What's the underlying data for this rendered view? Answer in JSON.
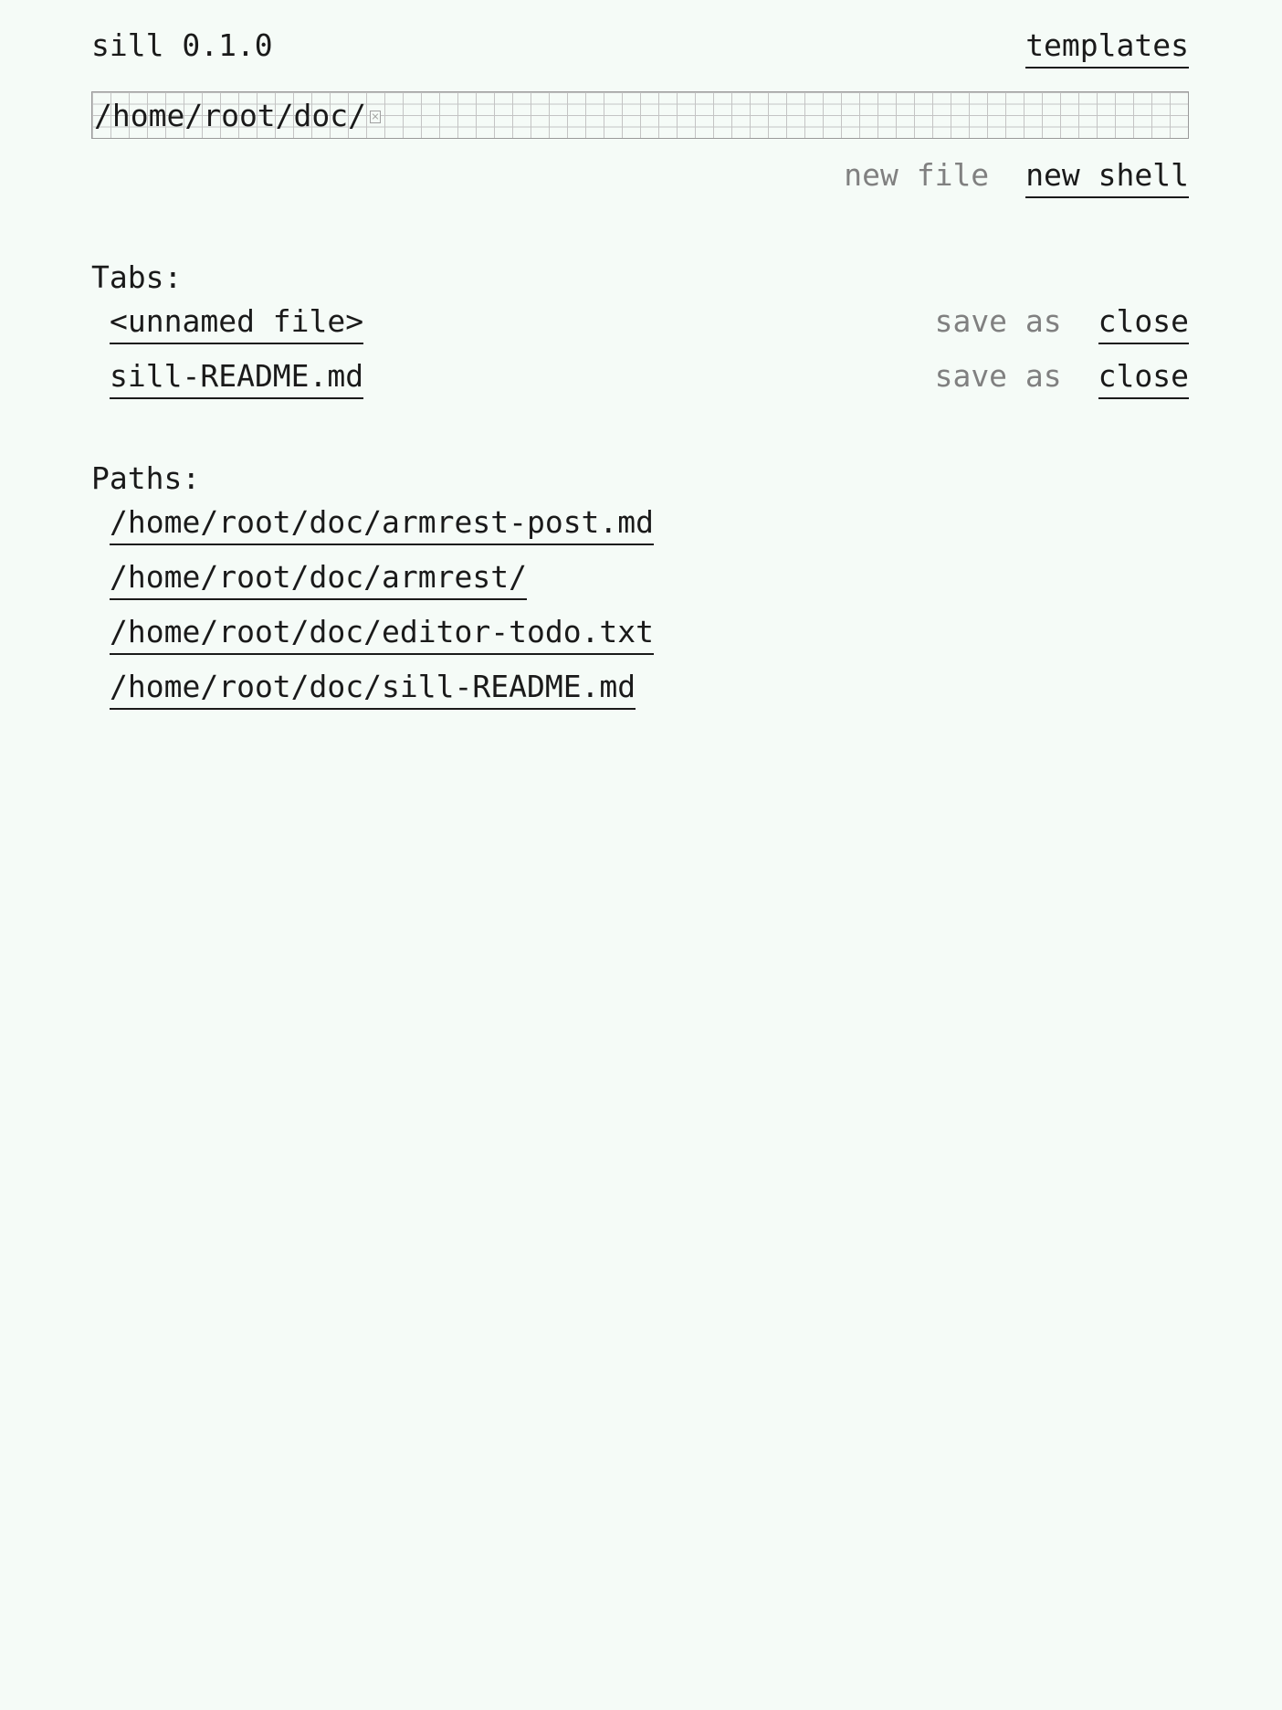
{
  "header": {
    "app_title": "sill 0.1.0",
    "templates_label": "templates"
  },
  "path_input": {
    "value": "/home/root/doc/"
  },
  "actions": {
    "new_file_label": "new file",
    "new_shell_label": "new shell"
  },
  "tabs": {
    "heading": "Tabs:",
    "items": [
      {
        "name": "<unnamed file>",
        "save_as_label": "save as",
        "close_label": "close"
      },
      {
        "name": "sill-README.md",
        "save_as_label": "save as",
        "close_label": "close"
      }
    ]
  },
  "paths": {
    "heading": "Paths:",
    "items": [
      "/home/root/doc/armrest-post.md",
      "/home/root/doc/armrest/",
      "/home/root/doc/editor-todo.txt",
      "/home/root/doc/sill-README.md"
    ]
  },
  "colors": {
    "background": "#f5fbf7",
    "text": "#1a1a1a",
    "disabled_text": "#808080",
    "input_grid": "#c4c4c4"
  }
}
